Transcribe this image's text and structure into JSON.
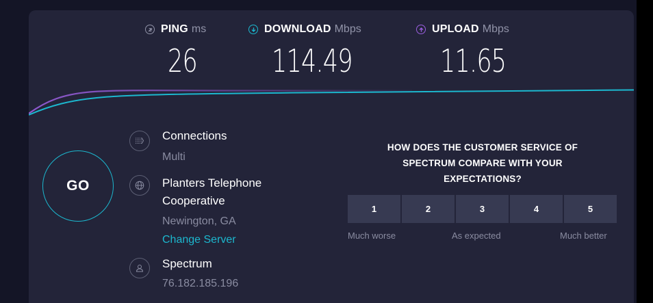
{
  "metrics": {
    "ping": {
      "name": "PING",
      "unit": "ms",
      "value": "26"
    },
    "download": {
      "name": "DOWNLOAD",
      "unit": "Mbps",
      "value": "114.49"
    },
    "upload": {
      "name": "UPLOAD",
      "unit": "Mbps",
      "value": "11.65"
    }
  },
  "go_label": "GO",
  "connections": {
    "title": "Connections",
    "value": "Multi"
  },
  "server": {
    "name_line1": "Planters Telephone",
    "name_line2": "Cooperative",
    "location": "Newington, GA",
    "change_label": "Change Server"
  },
  "provider": {
    "name": "Spectrum",
    "ip": "76.182.185.196"
  },
  "survey": {
    "question_line1": "HOW DOES THE CUSTOMER SERVICE OF",
    "question_line2": "SPECTRUM COMPARE WITH YOUR",
    "question_line3": "EXPECTATIONS?",
    "ratings": [
      "1",
      "2",
      "3",
      "4",
      "5"
    ],
    "label_low": "Much worse",
    "label_mid": "As expected",
    "label_high": "Much better"
  },
  "colors": {
    "background": "#141526",
    "card": "#232439",
    "accent_cyan": "#1cb8cf",
    "accent_purple": "#9b5fe0",
    "rating_button": "#373a52"
  },
  "icons": {
    "ping": "ping-icon",
    "download": "download-arrow-icon",
    "upload": "upload-arrow-icon",
    "connections": "connections-icon",
    "server": "globe-icon",
    "provider": "user-icon"
  }
}
